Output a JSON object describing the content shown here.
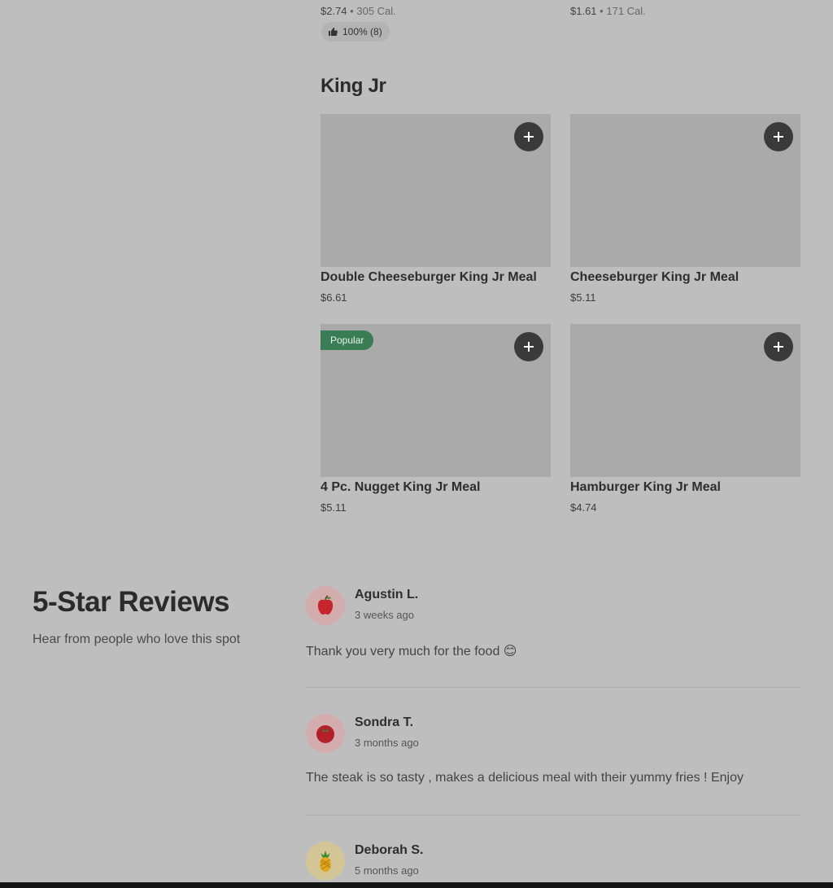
{
  "top_items": [
    {
      "price": "$2.74",
      "sep": "•",
      "calories": "305 Cal."
    },
    {
      "price": "$1.61",
      "sep": "•",
      "calories": "171 Cal."
    }
  ],
  "top_rating": {
    "text": "100% (8)",
    "icon": "thumbs-up-icon"
  },
  "section": {
    "title": "King Jr",
    "items": [
      {
        "name": "Double Cheeseburger King Jr Meal",
        "price": "$6.61",
        "badge": ""
      },
      {
        "name": "Cheeseburger King Jr Meal",
        "price": "$5.11",
        "badge": ""
      },
      {
        "name": "4 Pc. Nugget King Jr Meal",
        "price": "$5.11",
        "badge": "Popular"
      },
      {
        "name": "Hamburger King Jr Meal",
        "price": "$4.74",
        "badge": ""
      }
    ]
  },
  "reviews": {
    "title": "5-Star Reviews",
    "subtitle": "Hear from people who love this spot",
    "items": [
      {
        "name": "Agustin L.",
        "date": "3 weeks ago",
        "text": "Thank you very much for the food 😊",
        "avatar_icon": "apple-icon",
        "avatar_bg": "#d3adad"
      },
      {
        "name": "Sondra T.",
        "date": "3 months ago",
        "text": "The steak is so tasty , makes a delicious meal with their yummy fries ! Enjoy",
        "avatar_icon": "tomato-icon",
        "avatar_bg": "#d3adad"
      },
      {
        "name": "Deborah S.",
        "date": "5 months ago",
        "text": "",
        "avatar_icon": "pineapple-icon",
        "avatar_bg": "#d3c596"
      }
    ]
  },
  "colors": {
    "page_bg": "#bebebe",
    "image_placeholder": "#aaaaaa",
    "add_button": "#3a3a3a",
    "popular_badge": "#3a7d55"
  }
}
